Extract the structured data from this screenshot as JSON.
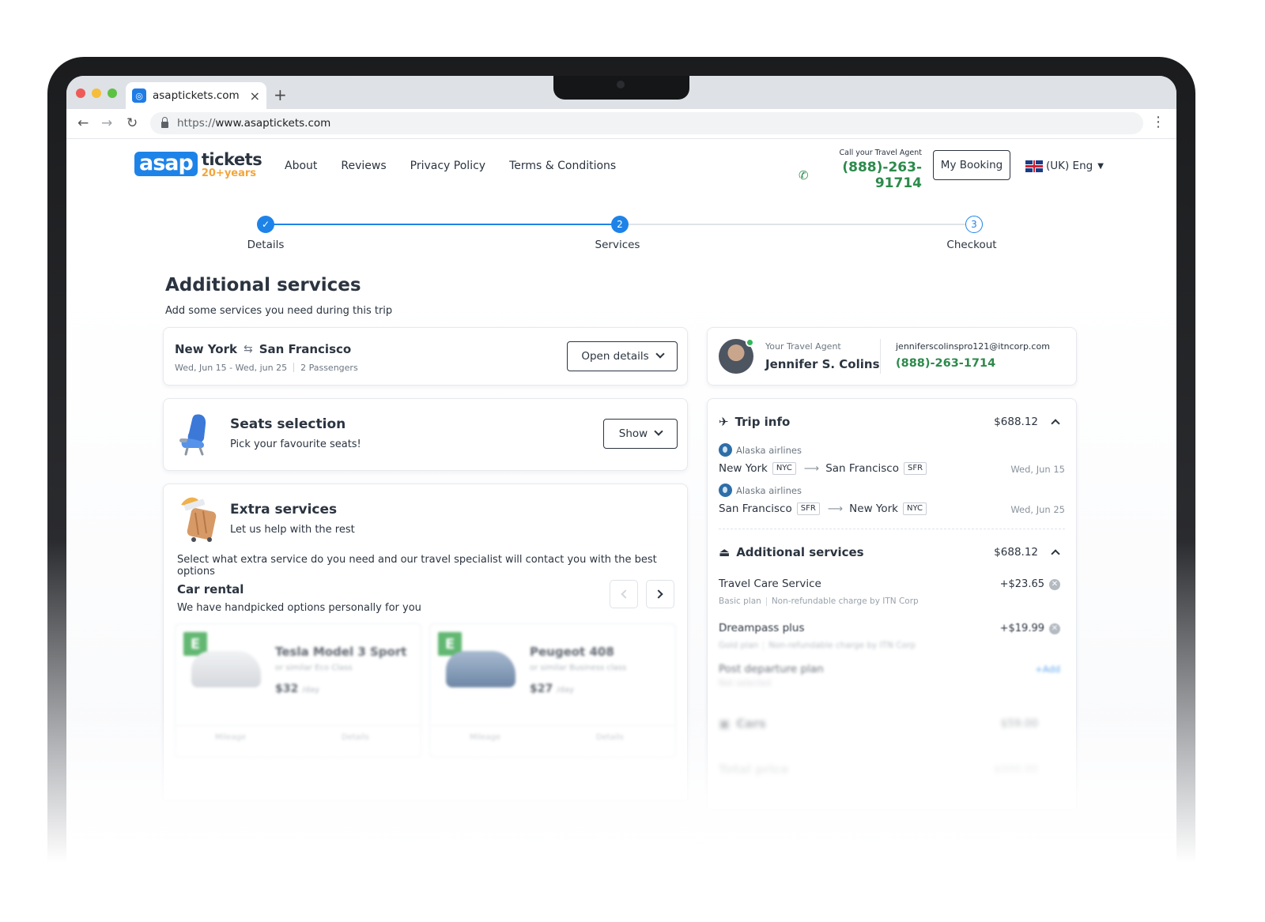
{
  "browser": {
    "tab_title": "asaptickets.com",
    "tab_close": "×",
    "new_tab": "+",
    "url_protocol": "https://",
    "url_rest": "www.asaptickets.com",
    "back": "←",
    "forward": "→",
    "reload": "↻",
    "menu": "⋮"
  },
  "header": {
    "logo_asap": "asap",
    "logo_tickets": "tickets",
    "logo_years": "20+years",
    "nav": [
      "About",
      "Reviews",
      "Privacy Policy",
      "Terms & Conditions"
    ],
    "call_label": "Call your Travel Agent",
    "phone": "(888)-263-91714",
    "my_booking": "My Booking",
    "language": "(UK) Eng"
  },
  "stepper": {
    "steps": [
      {
        "label": "Details",
        "marker": "✓",
        "state": "done"
      },
      {
        "label": "Services",
        "marker": "2",
        "state": "current"
      },
      {
        "label": "Checkout",
        "marker": "3",
        "state": "todo"
      }
    ]
  },
  "page": {
    "title": "Additional services",
    "subtitle": "Add some services you need during this trip"
  },
  "route": {
    "from": "New York",
    "swap_icon": "⇆",
    "to": "San Francisco",
    "dates": "Wed, Jun 15 - Wed, jun 25",
    "passengers": "2 Passengers",
    "open_details": "Open details"
  },
  "agent": {
    "label": "Your Travel Agent",
    "name": "Jennifer S. Colins",
    "email": "jenniferscolinspro121@itncorp.com",
    "phone": "(888)-263-1714"
  },
  "seats": {
    "title": "Seats selection",
    "subtitle": "Pick your favourite seats!",
    "button": "Show"
  },
  "extra": {
    "title": "Extra services",
    "subtitle": "Let us help with the rest",
    "description": "Select what extra service do you need and our travel specialist will contact you with the best options",
    "car_rental_title": "Car rental",
    "car_rental_subtitle": "We have handpicked options personally for you",
    "cars": [
      {
        "badge": "E",
        "name": "Tesla Model 3 Sport",
        "sub": "or similar Eco Class",
        "price": "$32",
        "per": "/day",
        "foot_left": "Mileage",
        "foot_right": "Details"
      },
      {
        "badge": "E",
        "name": "Peugeot 408",
        "sub": "or similar Business class",
        "price": "$27",
        "per": "/day",
        "foot_left": "Mileage",
        "foot_right": "Details"
      }
    ]
  },
  "summary": {
    "trip_info": {
      "title": "Trip info",
      "price": "$688.12",
      "legs": [
        {
          "airline": "Alaska airlines",
          "from": "New York",
          "from_code": "NYC",
          "to": "San Francisco",
          "to_code": "SFR",
          "date": "Wed, Jun 15"
        },
        {
          "airline": "Alaska airlines",
          "from": "San Francisco",
          "from_code": "SFR",
          "to": "New York",
          "to_code": "NYC",
          "date": "Wed, Jun 25"
        }
      ]
    },
    "additional": {
      "title": "Additional services",
      "price": "$688.12",
      "items": [
        {
          "name": "Travel Care Service",
          "price": "+$23.65",
          "plan": "Basic plan",
          "note": "Non-refundable charge by ITN Corp"
        },
        {
          "name": "Dreampass plus",
          "price": "+$19.99",
          "plan": "Gold plan",
          "note": "Non-refundable charge by ITN Corp"
        },
        {
          "name": "Post departure plan",
          "status": "Not selected",
          "action": "+Add"
        }
      ]
    },
    "faded_rows": [
      {
        "label": "Cars",
        "price": "$59.00"
      },
      {
        "label": "Total price",
        "price": "$000.00"
      }
    ]
  },
  "colors": {
    "primary": "#1e83e8",
    "success": "#2c8a4b",
    "text": "#2b3440",
    "logo_orange": "#f4a43a"
  }
}
